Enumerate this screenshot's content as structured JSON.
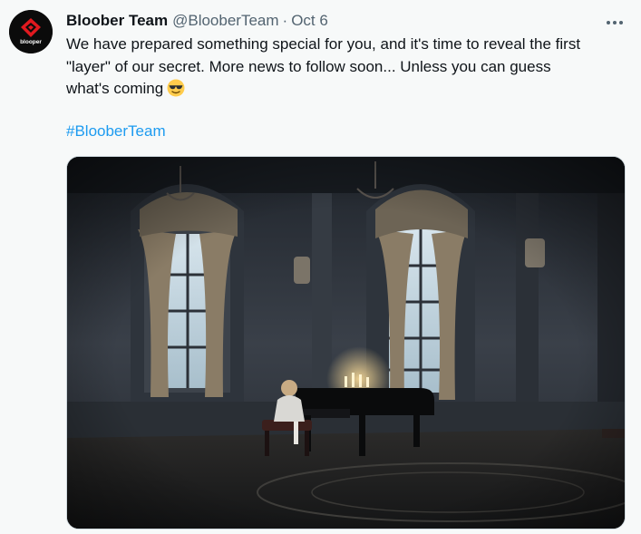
{
  "tweet": {
    "author": {
      "display_name": "Bloober Team",
      "handle": "@BlooberTeam",
      "avatar_icon": "bloober-logo-icon",
      "avatar_text": "blooper"
    },
    "separator": "·",
    "date": "Oct 6",
    "text_lines": [
      "We have prepared something special for you, and it's time to reveal the first",
      "\"layer\" of our secret.  More news to follow soon... Unless you can guess",
      "what's coming"
    ],
    "emoji": "smiling-face-with-sunglasses-icon",
    "hashtag": "#BlooberTeam",
    "media": {
      "type": "photo",
      "subject": "girl-playing-grand-piano-icon"
    },
    "more_icon": "more-horizontal-icon"
  },
  "colors": {
    "background": "#f7f9f9",
    "text": "#0f1419",
    "secondary_text": "#536471",
    "link": "#1d9bf0",
    "brand_red": "#e0191f"
  }
}
